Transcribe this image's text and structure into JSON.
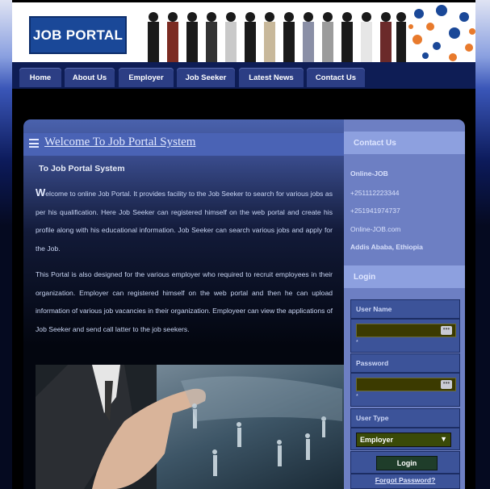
{
  "header": {
    "logo_text": "JOB PORTAL"
  },
  "nav": [
    {
      "label": "Home"
    },
    {
      "label": "About Us"
    },
    {
      "label": "Employer"
    },
    {
      "label": "Job Seeker"
    },
    {
      "label": "Latest News"
    },
    {
      "label": "Contact Us"
    }
  ],
  "main": {
    "title": "Welcome To Job Portal System",
    "subtitle": "To Job Portal System",
    "para1_cap": "W",
    "para1": "elcome to online Job Portal. It provides facility to the Job Seeker to search for various jobs as per his qualification. Here Job Seeker can registered himself on the web portal and create his profile along with his educational information. Job Seeker can search various jobs and apply for the Job.",
    "para2": "This Portal is also designed for the various employer who required to recruit employees in their organization. Employer can registered himself on the web portal and then he can upload information of various job vacancies in their organization. Employeer can view the applications of Job Seeker and send call latter to the job seekers."
  },
  "contact": {
    "heading": "Contact Us",
    "name": "Online-JOB",
    "phone1": "+251112223344",
    "phone2": "+251941974737",
    "site": "Online-JOB.com",
    "address": "Addis Ababa, Ethiopia"
  },
  "login": {
    "heading": "Login",
    "username_label": "User Name",
    "password_label": "Password",
    "required_mark": "*",
    "usertype_label": "User Type",
    "usertype_value": "Employer",
    "button": "Login",
    "forgot": "Forgot Password?"
  },
  "colors": {
    "brand_blue": "#1a4898",
    "nav": "#2c3e84",
    "sidebar": "#6d7fc3"
  }
}
